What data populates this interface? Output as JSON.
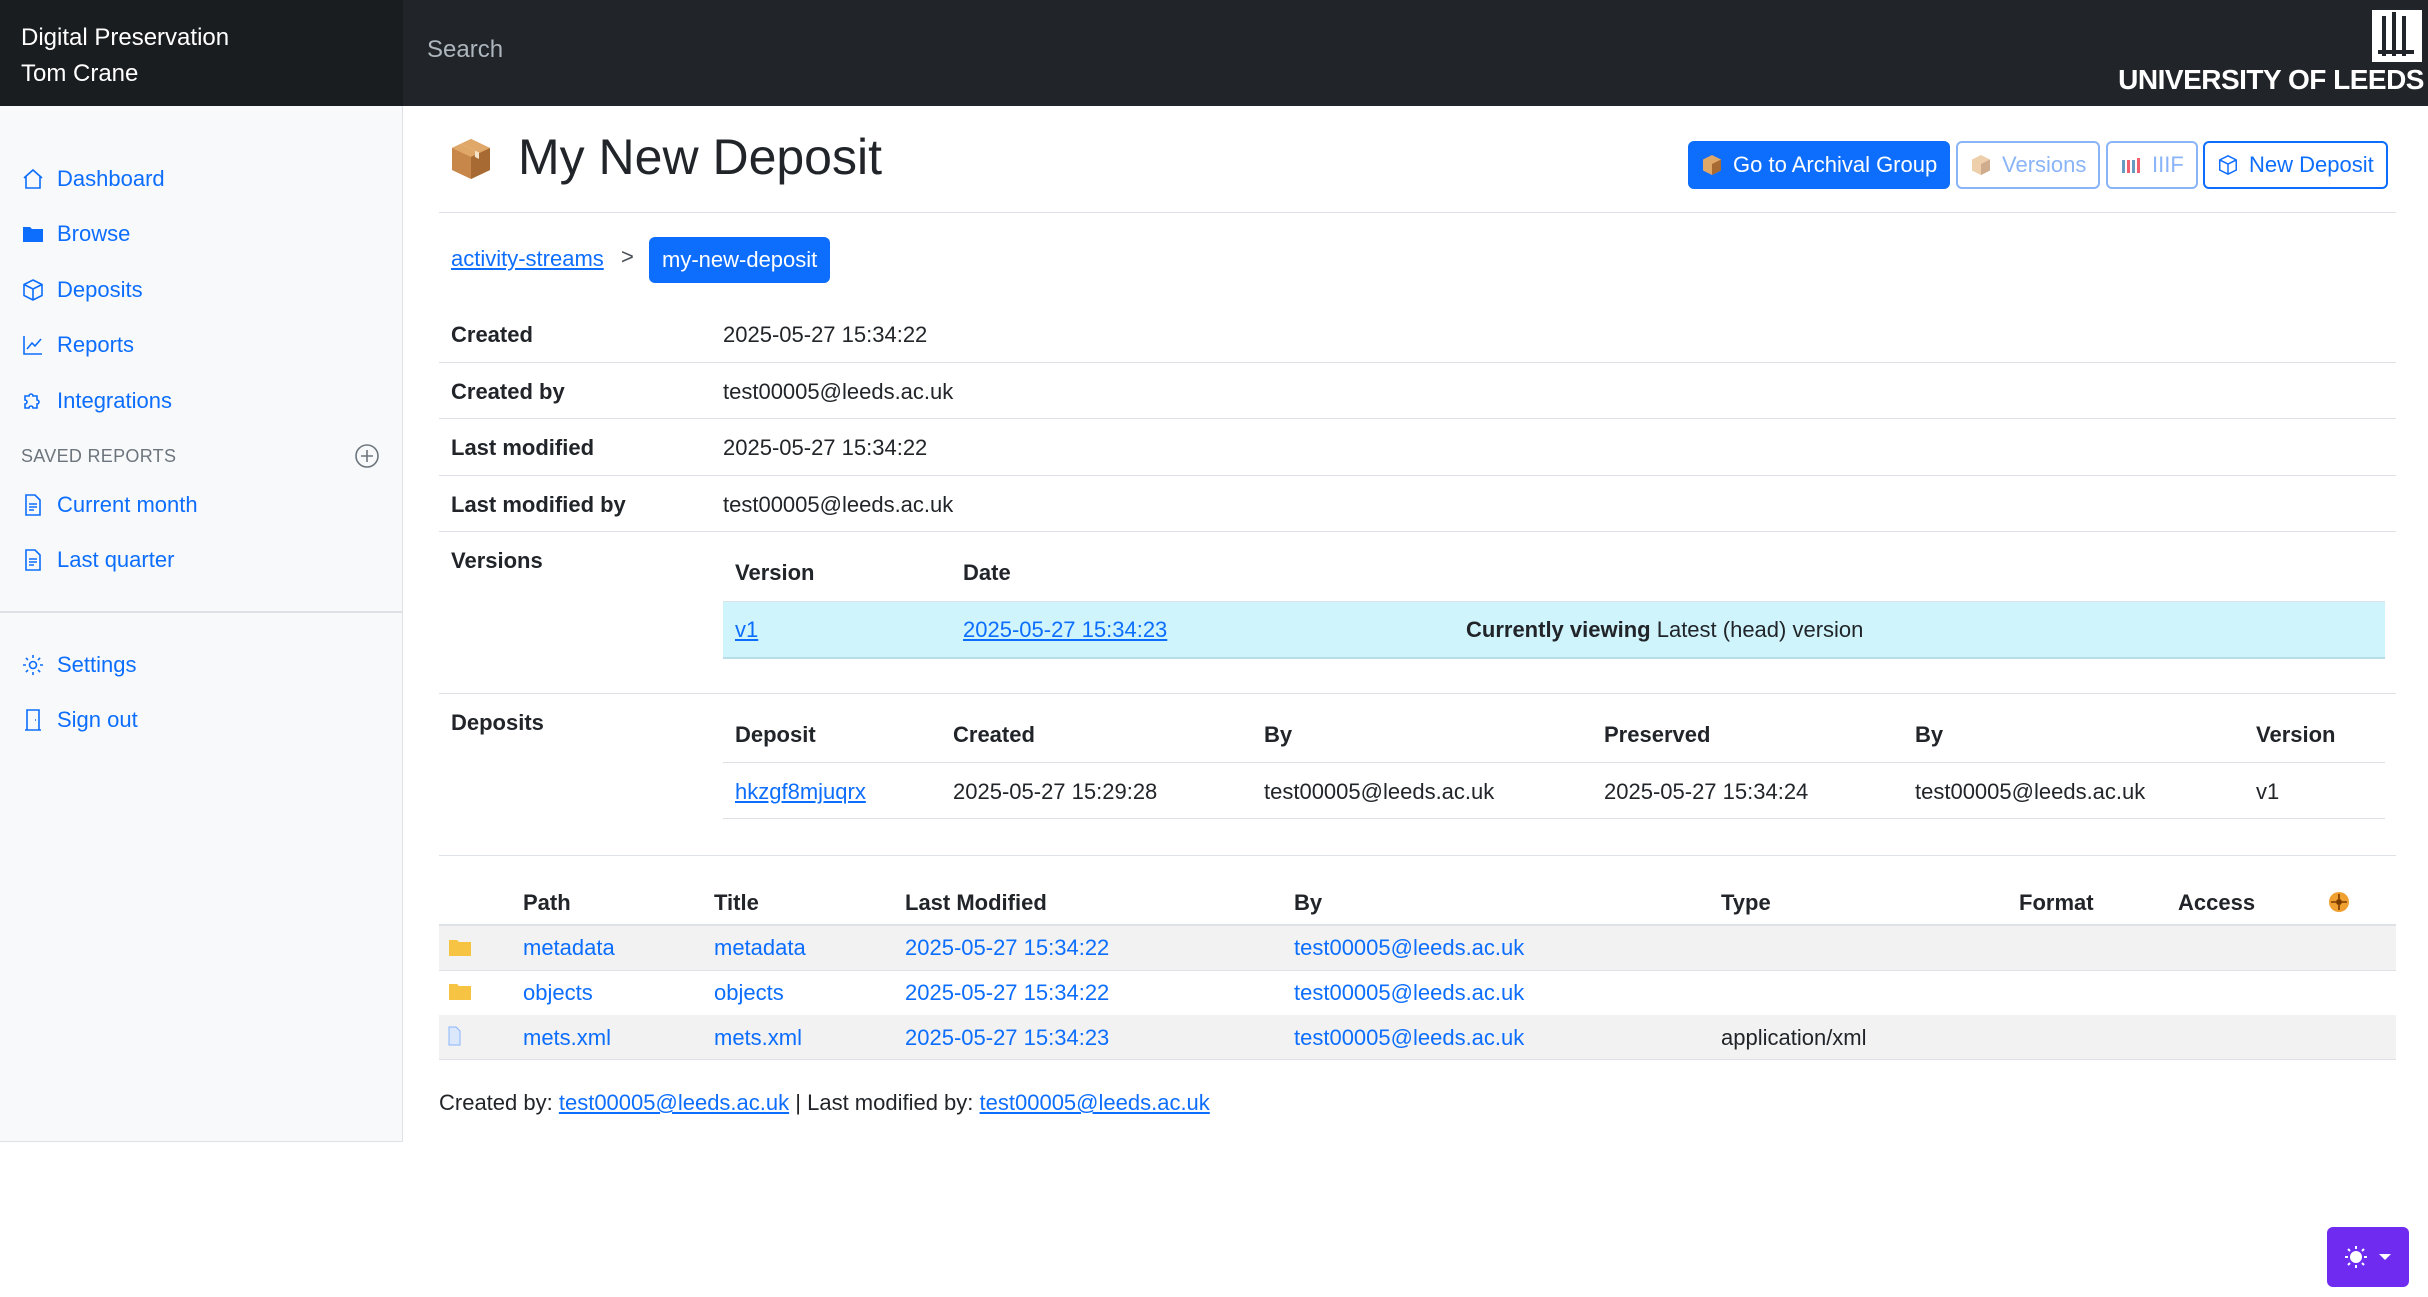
{
  "brand": {
    "app_name": "Digital Preservation",
    "user_name": "Tom Crane"
  },
  "search": {
    "placeholder": "Search"
  },
  "university": {
    "name": "UNIVERSITY OF LEEDS"
  },
  "sidebar": {
    "items": [
      {
        "label": "Dashboard",
        "icon": "house-icon"
      },
      {
        "label": "Browse",
        "icon": "folder-icon"
      },
      {
        "label": "Deposits",
        "icon": "box-icon"
      },
      {
        "label": "Reports",
        "icon": "graph-icon"
      },
      {
        "label": "Integrations",
        "icon": "puzzle-icon"
      }
    ],
    "saved_reports_header": "SAVED REPORTS",
    "saved_reports": [
      {
        "label": "Current month",
        "icon": "document-icon"
      },
      {
        "label": "Last quarter",
        "icon": "document-icon"
      }
    ],
    "settings_label": "Settings",
    "signout_label": "Sign out"
  },
  "page": {
    "title": "My New Deposit"
  },
  "toolbar": {
    "archival_group": "Go to Archival Group",
    "versions": "Versions",
    "iiif": "IIIF",
    "new_deposit": "New Deposit"
  },
  "breadcrumb": {
    "parent": "activity-streams",
    "separator": ">",
    "current": "my-new-deposit"
  },
  "properties": {
    "created_label": "Created",
    "created": "2025-05-27 15:34:22",
    "created_by_label": "Created by",
    "created_by": "test00005@leeds.ac.uk",
    "last_modified_label": "Last modified",
    "last_modified": "2025-05-27 15:34:22",
    "last_modified_by_label": "Last modified by",
    "last_modified_by": "test00005@leeds.ac.uk",
    "versions_label": "Versions",
    "deposits_label": "Deposits"
  },
  "versions_table": {
    "headers": {
      "version": "Version",
      "date": "Date"
    },
    "rows": [
      {
        "version": "v1",
        "date": "2025-05-27 15:34:23",
        "status_bold": "Currently viewing",
        "status": "Latest (head) version"
      }
    ]
  },
  "deposits_table": {
    "headers": {
      "deposit": "Deposit",
      "created": "Created",
      "by": "By",
      "preserved": "Preserved",
      "by2": "By",
      "version": "Version"
    },
    "rows": [
      {
        "deposit": "hkzgf8mjuqrx",
        "created": "2025-05-27 15:29:28",
        "by": "test00005@leeds.ac.uk",
        "preserved": "2025-05-27 15:34:24",
        "by2": "test00005@leeds.ac.uk",
        "version": "v1"
      }
    ]
  },
  "files_table": {
    "headers": {
      "path": "Path",
      "title": "Title",
      "last_modified": "Last Modified",
      "by": "By",
      "type": "Type",
      "format": "Format",
      "access": "Access"
    },
    "rows": [
      {
        "icon": "folder-icon",
        "path": "metadata",
        "title": "metadata",
        "last_modified": "2025-05-27 15:34:22",
        "by": "test00005@leeds.ac.uk",
        "type": ""
      },
      {
        "icon": "folder-icon",
        "path": "objects",
        "title": "objects",
        "last_modified": "2025-05-27 15:34:22",
        "by": "test00005@leeds.ac.uk",
        "type": ""
      },
      {
        "icon": "file-icon",
        "path": "mets.xml",
        "title": "mets.xml",
        "last_modified": "2025-05-27 15:34:23",
        "by": "test00005@leeds.ac.uk",
        "type": "application/xml"
      }
    ]
  },
  "footer": {
    "created_by_label": "Created by:",
    "created_by": "test00005@leeds.ac.uk",
    "separator": "|",
    "last_modified_by_label": "Last modified by:",
    "last_modified_by": "test00005@leeds.ac.uk"
  },
  "colors": {
    "primary": "#0d6efd",
    "topbar": "#212529",
    "highlight_row": "#cff4fc",
    "theme_button": "#6f2cf0"
  }
}
